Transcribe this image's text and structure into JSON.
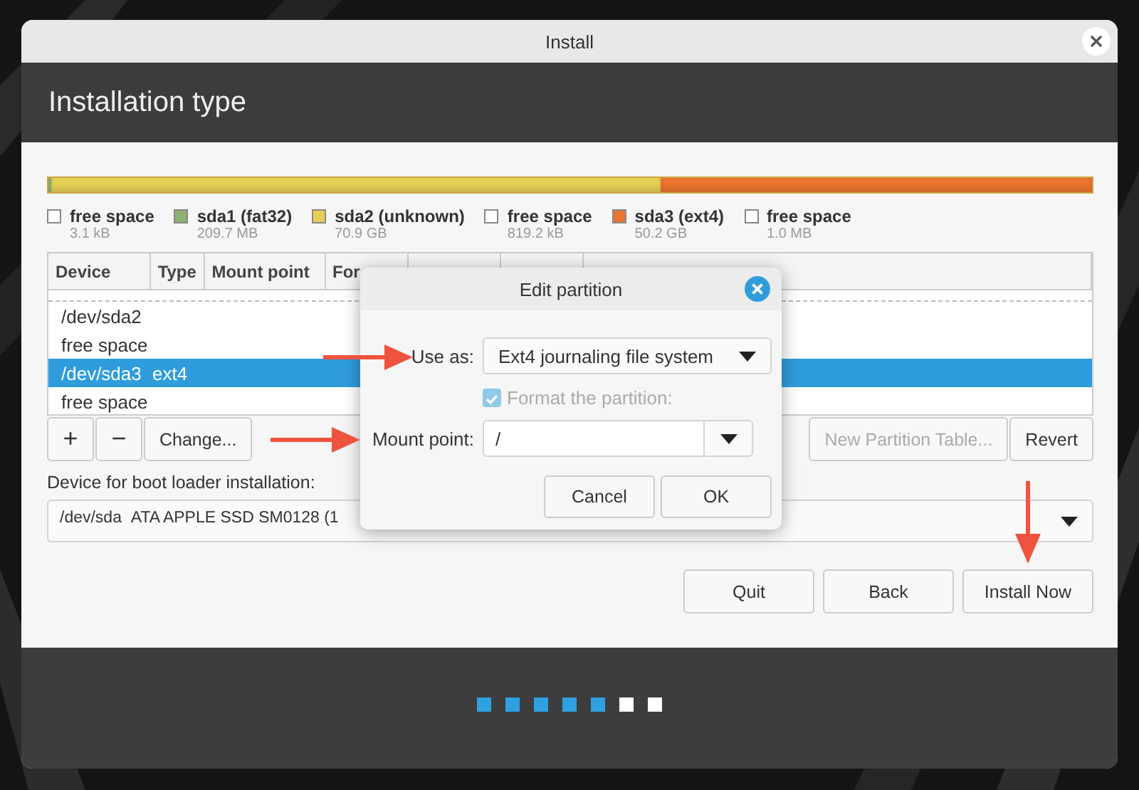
{
  "window": {
    "title": "Install",
    "heading": "Installation type"
  },
  "partition_bar": [
    {
      "color": "#8fb171",
      "level": 0.003
    },
    {
      "color": "#e6cf55",
      "level": 0.584
    },
    {
      "color": "#ea7430",
      "level": 0.413
    }
  ],
  "legend": [
    {
      "label": "free space",
      "size": "3.1 kB",
      "color": "#ffffff"
    },
    {
      "label": "sda1 (fat32)",
      "size": "209.7 MB",
      "color": "#8fb171"
    },
    {
      "label": "sda2 (unknown)",
      "size": "70.9 GB",
      "color": "#e6cf55"
    },
    {
      "label": "free space",
      "size": "819.2 kB",
      "color": "#ffffff"
    },
    {
      "label": "sda3 (ext4)",
      "size": "50.2 GB",
      "color": "#ea7430"
    },
    {
      "label": "free space",
      "size": "1.0 MB",
      "color": "#ffffff"
    }
  ],
  "table": {
    "columns": [
      "Device",
      "Type",
      "Mount point",
      "For"
    ],
    "rows": [
      {
        "device": "/dev/sda2",
        "selected": false
      },
      {
        "device": "free space",
        "selected": false
      },
      {
        "device": "/dev/sda3",
        "type": "ext4",
        "selected": true
      },
      {
        "device": "free space",
        "selected": false
      }
    ]
  },
  "partition_buttons": [
    {
      "label": "+",
      "disabled": false
    },
    {
      "label": "−",
      "disabled": false
    },
    {
      "label": "Change...",
      "disabled": false
    }
  ],
  "table_buttons": [
    {
      "label": "New Partition Table...",
      "disabled": true
    },
    {
      "label": "Revert",
      "disabled": false
    }
  ],
  "boot_loader": {
    "label": "Device for boot loader installation:",
    "device": "/dev/sda",
    "model": "ATA APPLE SSD SM0128 (1"
  },
  "nav_buttons": [
    {
      "label": "Quit"
    },
    {
      "label": "Back"
    },
    {
      "label": "Install Now"
    }
  ],
  "steps": [
    {
      "done": true
    },
    {
      "done": true
    },
    {
      "done": true
    },
    {
      "done": true
    },
    {
      "done": true
    },
    {
      "done": false
    },
    {
      "done": false
    }
  ],
  "dialog": {
    "title": "Edit partition",
    "use_as_label": "Use as:",
    "use_as": "Ext4 journaling file system",
    "format": {
      "label": "Format the partition:",
      "checked": true,
      "disabled": true
    },
    "mount_label": "Mount point:",
    "mount_point": "/",
    "buttons": [
      "Cancel",
      "OK"
    ]
  }
}
